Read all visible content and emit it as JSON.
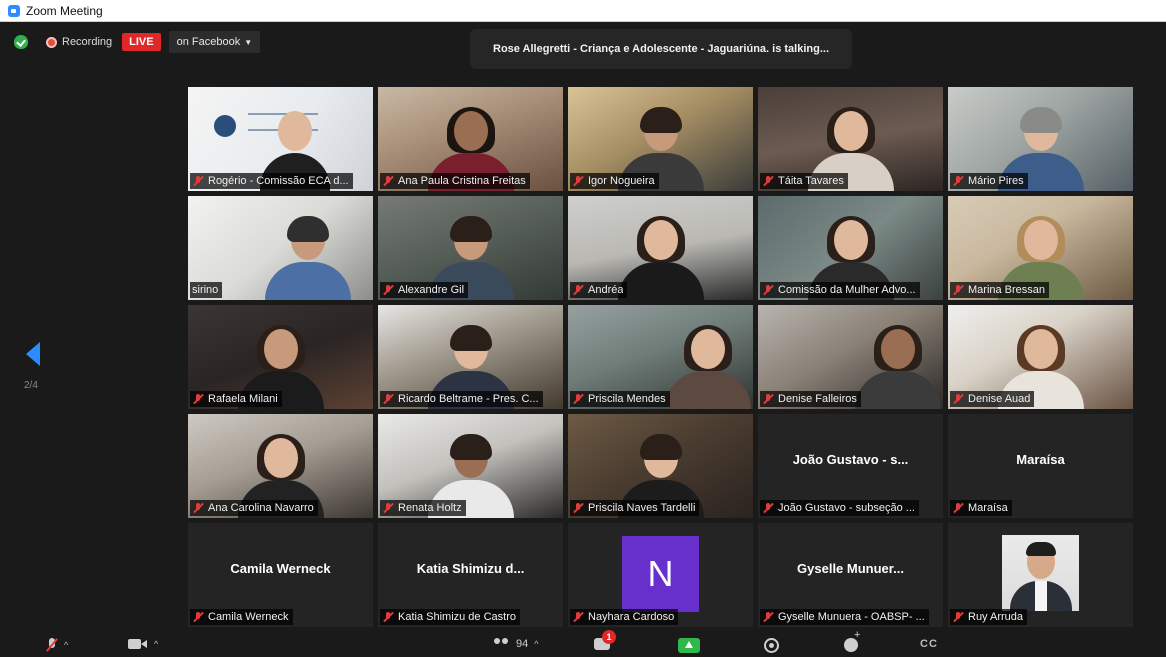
{
  "window": {
    "title": "Zoom Meeting"
  },
  "topbar": {
    "recording_label": "Recording",
    "live_label": "LIVE",
    "live_destination": "on Facebook"
  },
  "speaker": {
    "text": "Rose Allegretti  - Criança e Adolescente - Jaguariúna. is talking..."
  },
  "pagination": {
    "label": "2/4"
  },
  "participants": [
    {
      "name": "Rogério - Comissão ECA d..."
    },
    {
      "name": "Ana Paula Cristina Freitas"
    },
    {
      "name": "Igor Nogueira"
    },
    {
      "name": "Táita Tavares"
    },
    {
      "name": "Mário Pires"
    },
    {
      "name": "sirino"
    },
    {
      "name": "Alexandre Gil"
    },
    {
      "name": "Andréa"
    },
    {
      "name": "Comissão da Mulher Advo..."
    },
    {
      "name": "Marina Bressan"
    },
    {
      "name": "Rafaela Milani"
    },
    {
      "name": "Ricardo Beltrame - Pres. C..."
    },
    {
      "name": "Priscila Mendes"
    },
    {
      "name": "Denise Falleiros"
    },
    {
      "name": "Denise Auad"
    },
    {
      "name": "Ana Carolina Navarro"
    },
    {
      "name": "Renata Holtz"
    },
    {
      "name": "Priscila Naves Tardelli"
    },
    {
      "name": "João Gustavo - subseção ...",
      "display": "João Gustavo - s..."
    },
    {
      "name": "Maraísa",
      "display": "Maraísa"
    },
    {
      "name": "Camila Werneck",
      "display": "Camila Werneck"
    },
    {
      "name": "Katia Shimizu de Castro",
      "display": "Katia Shimizu d..."
    },
    {
      "name": "Nayhara Cardoso",
      "avatar_letter": "N"
    },
    {
      "name": "Gyselle Munuera - OABSP- ...",
      "display": "Gyselle  Munuer..."
    },
    {
      "name": "Ruy Arruda"
    }
  ],
  "toolbar": {
    "participants_count": "94",
    "chat_badge": "1",
    "cc_label": "CC"
  },
  "colors": {
    "zoom_blue": "#2d8cff",
    "live_red": "#e02828",
    "share_green": "#2eb94a",
    "avatar_purple": "#672fcb"
  }
}
